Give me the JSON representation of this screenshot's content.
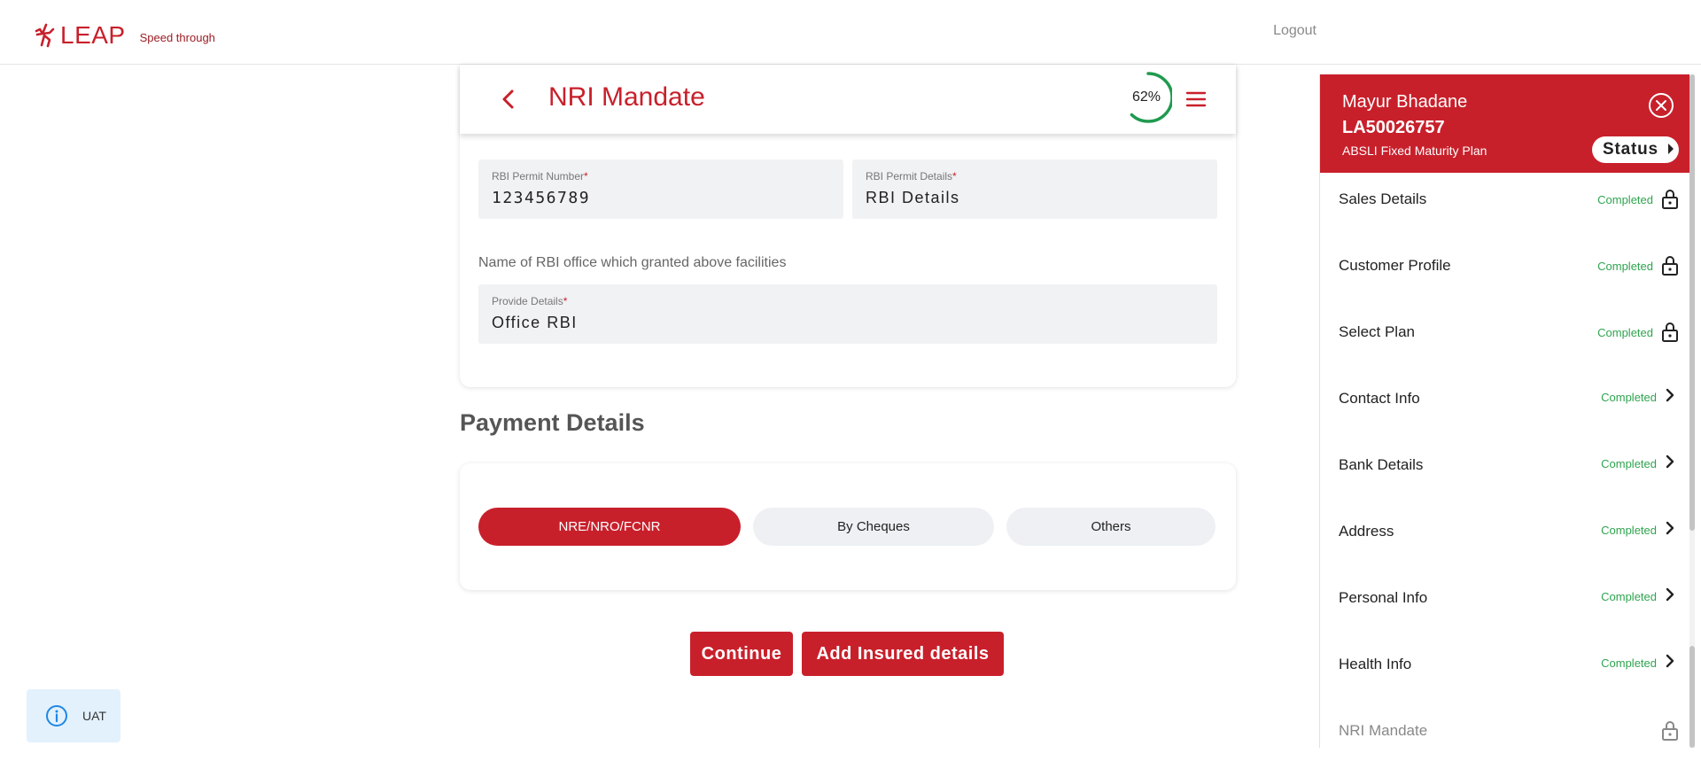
{
  "header": {
    "logo_text": "LEAP",
    "tagline": "Speed through",
    "logout_label": "Logout"
  },
  "form": {
    "title": "NRI Mandate",
    "progress": "62%",
    "progress_value": 0.62,
    "fields": {
      "rbi_permit_number": {
        "label": "RBI Permit Number",
        "value": "123456789"
      },
      "rbi_permit_details": {
        "label": "RBI Permit Details",
        "value": "RBI Details"
      },
      "provide_details": {
        "label": "Provide Details",
        "value": "Office RBI"
      }
    },
    "required_mark": "*",
    "question": "Name of RBI office which granted above facilities"
  },
  "payment": {
    "title": "Payment Details",
    "options": [
      "NRE/NRO/FCNR",
      "By Cheques",
      "Others"
    ],
    "selected": "NRE/NRO/FCNR"
  },
  "actions": {
    "continue_label": "Continue",
    "add_insured_label": "Add Insured details"
  },
  "env_badge": {
    "label": "UAT"
  },
  "panel": {
    "name": "Mayur Bhadane",
    "application_id": "LA50026757",
    "plan": "ABSLI Fixed Maturity Plan",
    "status_label": "Status",
    "items": [
      {
        "label": "Sales Details",
        "status": "Completed",
        "icon": "lock-icon"
      },
      {
        "label": "Customer Profile",
        "status": "Completed",
        "icon": "lock-icon"
      },
      {
        "label": "Select Plan",
        "status": "Completed",
        "icon": "lock-icon"
      },
      {
        "label": "Contact Info",
        "status": "Completed",
        "icon": "chevron-right-icon"
      },
      {
        "label": "Bank Details",
        "status": "Completed",
        "icon": "chevron-right-icon"
      },
      {
        "label": "Address",
        "status": "Completed",
        "icon": "chevron-right-icon"
      },
      {
        "label": "Personal Info",
        "status": "Completed",
        "icon": "chevron-right-icon"
      },
      {
        "label": "Health Info",
        "status": "Completed",
        "icon": "chevron-right-icon"
      },
      {
        "label": "NRI Mandate",
        "status": "",
        "icon": "lock-icon"
      }
    ]
  },
  "colors": {
    "brand": "#c8202b",
    "success": "#2fa44f",
    "progress_ring": "#1f9a4f"
  }
}
